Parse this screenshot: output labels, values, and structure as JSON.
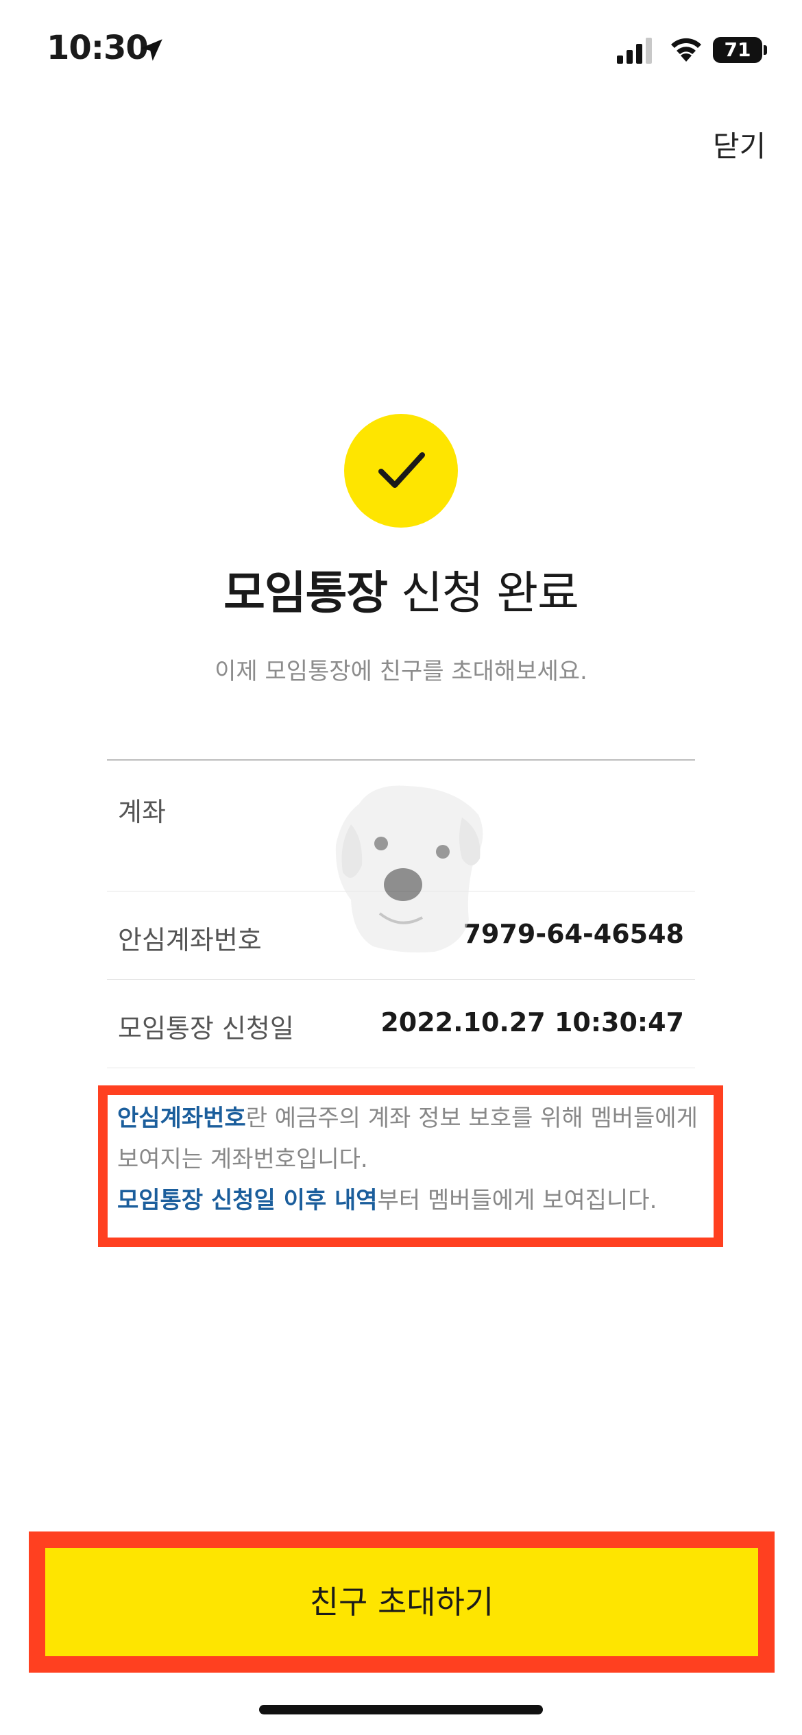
{
  "status_bar": {
    "time": "10:30",
    "battery": "71"
  },
  "header": {
    "close_label": "닫기"
  },
  "main": {
    "title_bold": "모임통장",
    "title_rest": " 신청 완료",
    "subtitle": "이제 모임통장에 친구를 초대해보세요.",
    "rows": [
      {
        "label": "계좌",
        "value": ""
      },
      {
        "label": "안심계좌번호",
        "value": "7979-64-46548"
      },
      {
        "label": "모임통장 신청일",
        "value": "2022.10.27 10:30:47"
      }
    ],
    "notice": {
      "line1_highlight": "안심계좌번호",
      "line1_rest": "란 예금주의 계좌 정보 보호를 위해 멤버들에게 보여지는 계좌번호입니다.",
      "line2_highlight": "모임통장 신청일 이후 내역",
      "line2_rest": "부터 멤버들에게 보여집니다."
    }
  },
  "footer": {
    "invite_button_label": "친구 초대하기"
  },
  "colors": {
    "accent_yellow": "#FEE500",
    "highlight_blue": "#1b5e9c",
    "annotation_red": "#ff4020"
  }
}
